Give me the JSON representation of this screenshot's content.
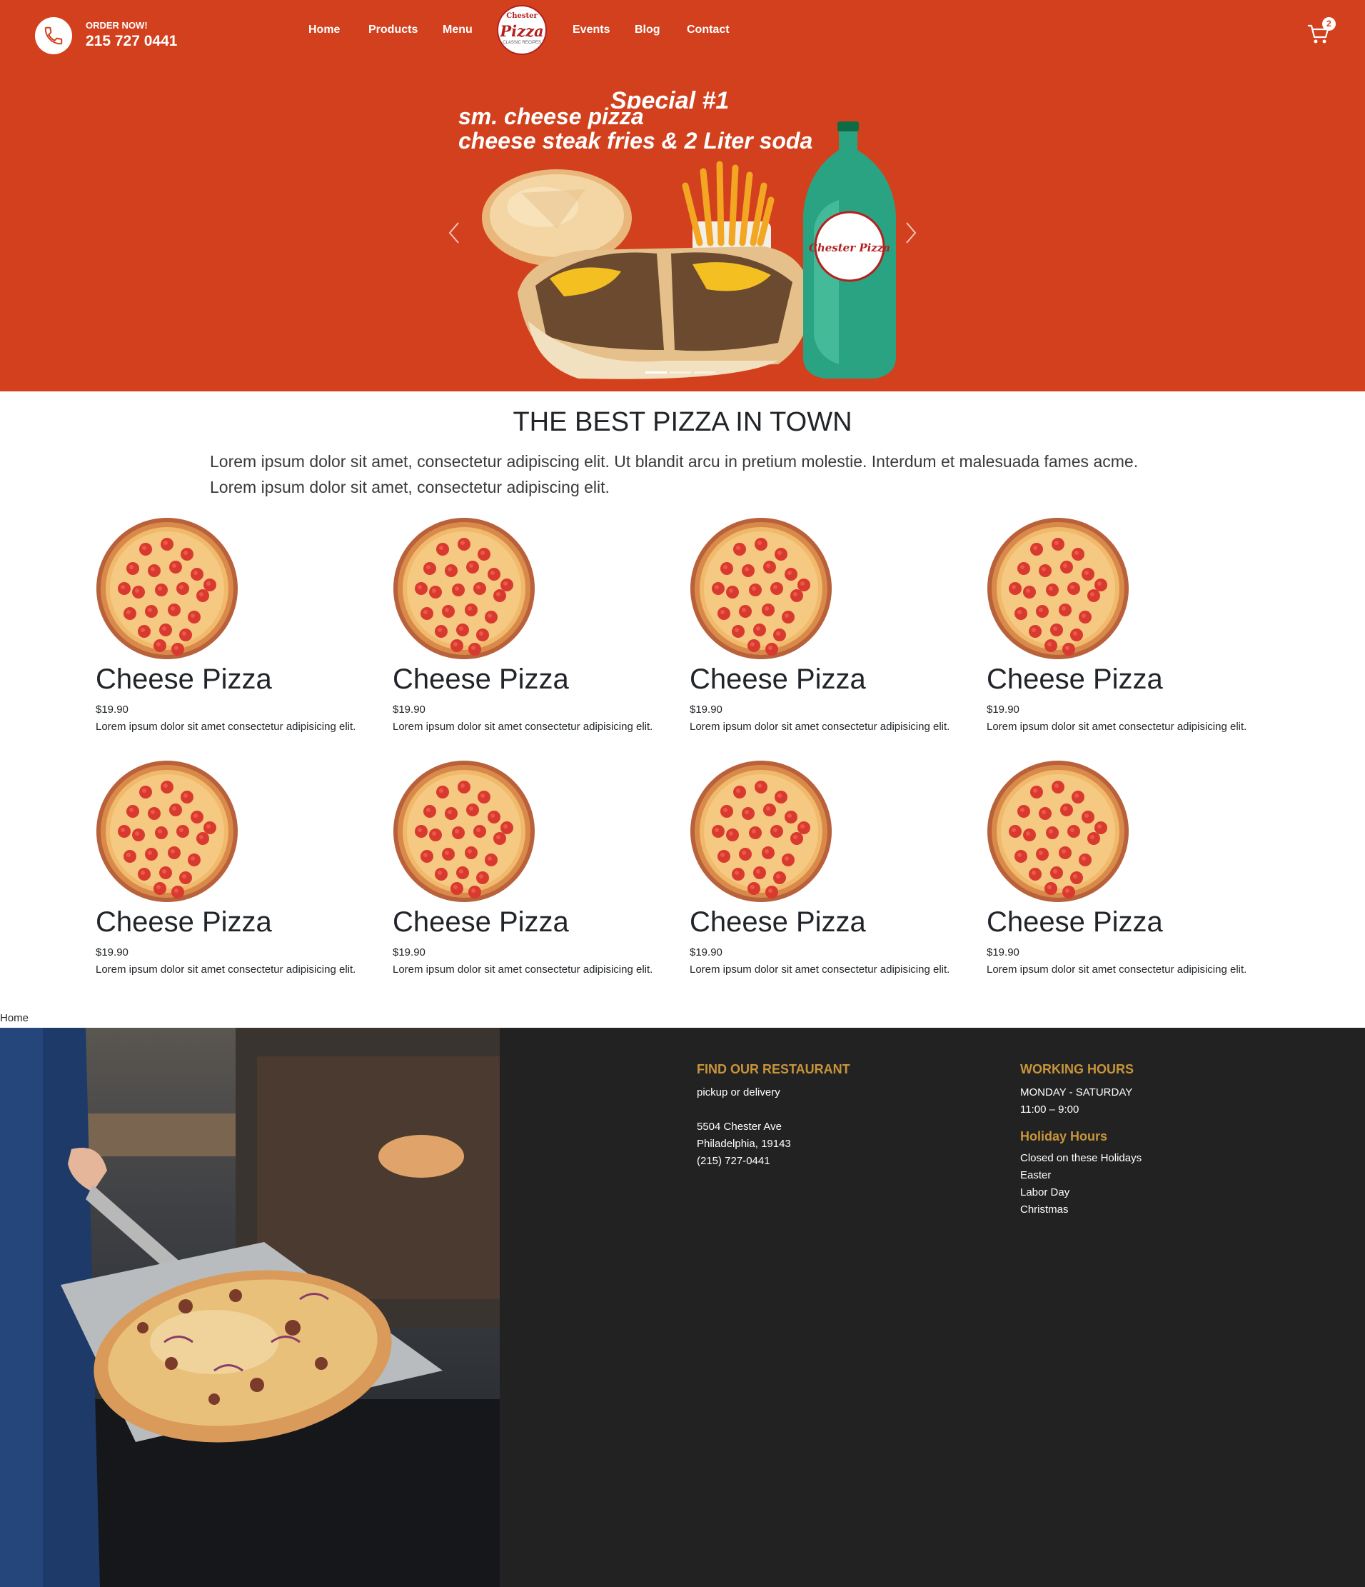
{
  "header": {
    "order_label": "ORDER NOW!",
    "order_phone": "215 727 0441",
    "nav": [
      "Home",
      "Products",
      "Menu",
      "Events",
      "Blog",
      "Contact"
    ],
    "logo": {
      "top": "Chester",
      "main": "Pizza",
      "bottom": "CLASSIC RECIPES"
    },
    "cart_count": "2"
  },
  "slider": {
    "title": "Special #1",
    "line1": "sm. cheese pizza",
    "line2": "cheese steak fries & 2 Liter soda",
    "bottle_logo": "Chester Pizza",
    "slide_count": 3,
    "active_slide": 1
  },
  "intro": {
    "title": "THE BEST PIZZA IN TOWN",
    "text": "Lorem ipsum dolor sit amet, consectetur adipiscing elit. Ut blandit arcu in pretium molestie. Interdum et malesuada fames acme. Lorem ipsum dolor sit amet, consectetur adipiscing elit."
  },
  "products": [
    {
      "name": "Cheese Pizza",
      "price": "$19.90",
      "desc": "Lorem ipsum dolor sit amet consectetur adipisicing elit."
    },
    {
      "name": "Cheese Pizza",
      "price": "$19.90",
      "desc": "Lorem ipsum dolor sit amet consectetur adipisicing elit."
    },
    {
      "name": "Cheese Pizza",
      "price": "$19.90",
      "desc": "Lorem ipsum dolor sit amet consectetur adipisicing elit."
    },
    {
      "name": "Cheese Pizza",
      "price": "$19.90",
      "desc": "Lorem ipsum dolor sit amet consectetur adipisicing elit."
    },
    {
      "name": "Cheese Pizza",
      "price": "$19.90",
      "desc": "Lorem ipsum dolor sit amet consectetur adipisicing elit."
    },
    {
      "name": "Cheese Pizza",
      "price": "$19.90",
      "desc": "Lorem ipsum dolor sit amet consectetur adipisicing elit."
    },
    {
      "name": "Cheese Pizza",
      "price": "$19.90",
      "desc": "Lorem ipsum dolor sit amet consectetur adipisicing elit."
    },
    {
      "name": "Cheese Pizza",
      "price": "$19.90",
      "desc": "Lorem ipsum dolor sit amet consectetur adipisicing elit."
    }
  ],
  "breadcrumb": "Home",
  "footer": {
    "find_title": "FIND OUR RESTAURANT",
    "find_sub": "pickup or delivery",
    "address1": "5504 Chester Ave",
    "address2": "Philadelphia, 19143",
    "phone": "(215) 727-0441",
    "hours_title": "WORKING HOURS",
    "days": "MONDAY - SATURDAY",
    "hours": "11:00 – 9:00",
    "holiday_title": "Holiday Hours",
    "holiday_sub": "Closed on these Holidays",
    "holidays": [
      "Easter",
      "Labor Day",
      "Christmas"
    ]
  },
  "colors": {
    "brand": "#d3401d",
    "footer_bg": "#222222",
    "footer_heading": "#c8953a"
  },
  "icons": [
    "phone-icon",
    "cart-icon",
    "chevron-left-icon",
    "chevron-right-icon"
  ]
}
